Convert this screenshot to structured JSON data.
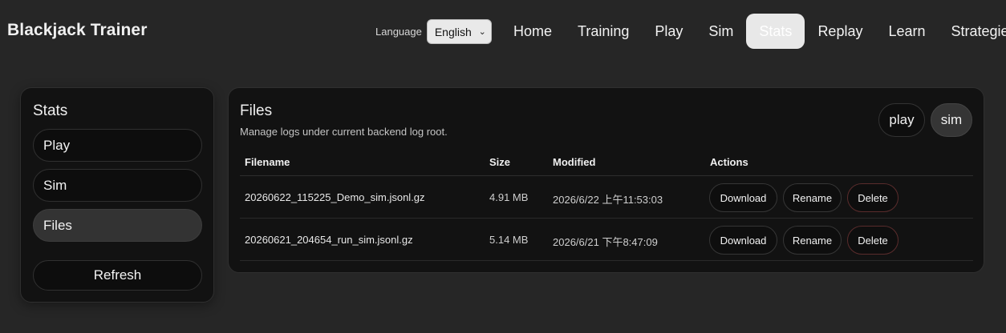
{
  "app": {
    "title": "Blackjack Trainer"
  },
  "language": {
    "label": "Language",
    "selected": "English"
  },
  "nav": {
    "items": [
      {
        "label": "Home"
      },
      {
        "label": "Training"
      },
      {
        "label": "Play"
      },
      {
        "label": "Sim"
      },
      {
        "label": "Stats",
        "active": true
      },
      {
        "label": "Replay"
      },
      {
        "label": "Learn"
      },
      {
        "label": "Strategies"
      }
    ]
  },
  "sidebar": {
    "title": "Stats",
    "items": [
      {
        "label": "Play"
      },
      {
        "label": "Sim"
      },
      {
        "label": "Files",
        "active": true
      }
    ],
    "refresh_label": "Refresh"
  },
  "files": {
    "title": "Files",
    "subtitle": "Manage logs under current backend log root.",
    "filters": [
      {
        "label": "play"
      },
      {
        "label": "sim",
        "active": true
      }
    ],
    "columns": [
      "Filename",
      "Size",
      "Modified",
      "Actions"
    ],
    "rows": [
      {
        "filename": "20260622_115225_Demo_sim.jsonl.gz",
        "size": "4.91 MB",
        "modified": "2026/6/22 上午11:53:03"
      },
      {
        "filename": "20260621_204654_run_sim.jsonl.gz",
        "size": "5.14 MB",
        "modified": "2026/6/21 下午8:47:09"
      }
    ],
    "actions": {
      "download": "Download",
      "rename": "Rename",
      "delete": "Delete"
    }
  },
  "colors": {
    "background": "#262626",
    "panel": "#121212",
    "active_nav": "#e8e8e8",
    "delete_border": "#5a2c2c"
  }
}
